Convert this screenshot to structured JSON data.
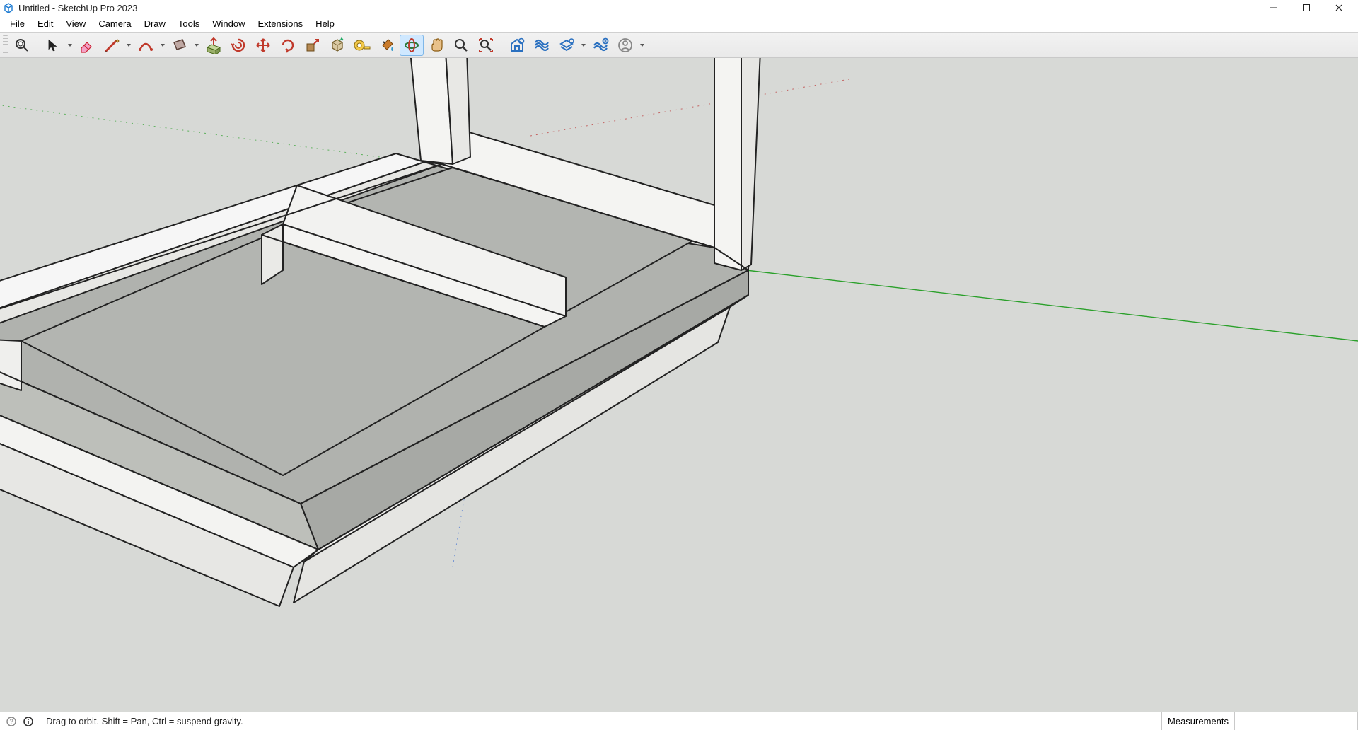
{
  "window": {
    "title": "Untitled - SketchUp Pro 2023"
  },
  "menu": [
    "File",
    "Edit",
    "View",
    "Camera",
    "Draw",
    "Tools",
    "Window",
    "Extensions",
    "Help"
  ],
  "toolbar": {
    "active_tool": "orbit"
  },
  "status": {
    "hint": "Drag to orbit. Shift = Pan, Ctrl = suspend gravity.",
    "measurements_label": "Measurements",
    "measurements_value": ""
  }
}
